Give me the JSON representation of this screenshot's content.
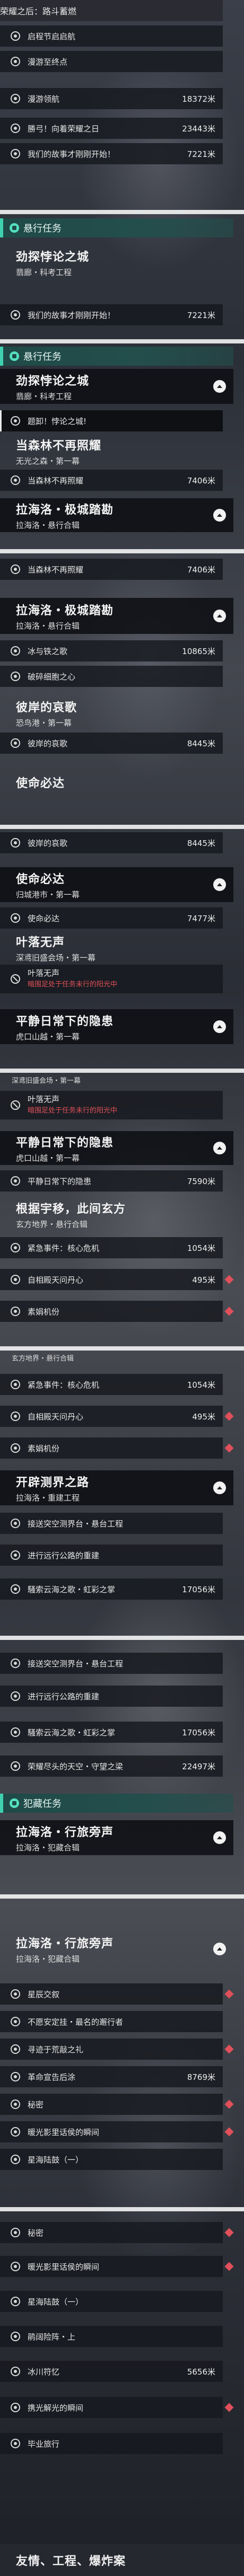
{
  "s1": {
    "top_item": "荣耀之后：路斗蓄燃",
    "rows": [
      {
        "label": "启程节启启航",
        "dist": ""
      },
      {
        "label": "漫游至终点",
        "dist": ""
      },
      {
        "label": "漫游领航",
        "dist": "18372米"
      },
      {
        "label": "勝弓！向着荣耀之日",
        "dist": "23443米"
      },
      {
        "label": "我们的故事才刚刚开始！",
        "dist": "7221米"
      }
    ]
  },
  "s2": {
    "section": "悬行任务",
    "group_title": "劲探悖论之城",
    "group_sub": "翡廊・科考工程",
    "row": {
      "label": "我们的故事才刚刚开始！",
      "dist": "7221米"
    }
  },
  "s3": {
    "section": "悬行任务",
    "group1": {
      "title": "劲探悖论之城",
      "sub": "翡廊・科考工程"
    },
    "row1": {
      "label": "题卸！悖论之城!"
    },
    "group2": {
      "title": "当森林不再照耀",
      "sub": "无光之森・第一幕"
    },
    "row2": {
      "label": "当森林不再照耀",
      "dist": "7406米"
    },
    "group3": {
      "title": "拉海洛・极城踏勘",
      "sub": "拉海洛・悬行合辑"
    }
  },
  "s4": {
    "row0": {
      "label": "当森林不再照耀",
      "dist": "7406米"
    },
    "group1": {
      "title": "拉海洛・极城踏勘",
      "sub": "拉海洛・悬行合辑"
    },
    "rows1": [
      {
        "label": "冰与铁之歌",
        "dist": "10865米"
      },
      {
        "label": "破碎细胞之心",
        "dist": ""
      }
    ],
    "group2": {
      "title": "彼岸的哀歌",
      "sub": "恐鸟港・第一幕"
    },
    "row2": {
      "label": "彼岸的哀歌",
      "dist": "8445米"
    },
    "group3": {
      "title": "使命必达"
    }
  },
  "s5": {
    "row0": {
      "label": "彼岸的哀歌",
      "dist": "8445米"
    },
    "group1": {
      "title": "使命必达",
      "sub": "归城港市・第一幕"
    },
    "row1": {
      "label": "使命必达",
      "dist": "7477米"
    },
    "group2": {
      "title": "叶落无声",
      "sub": "深鸢旧盛会场・第一幕"
    },
    "row2": {
      "label": "叶落无声",
      "note": "暗围足处于任务未行的阳光中"
    },
    "group3": {
      "title": "平静日常下的隐患",
      "sub": "虎口山越・第一幕"
    }
  },
  "s6": {
    "top_text": "深鸢旧盛会场・第一幕",
    "row1": {
      "label": "叶落无声",
      "note": "暗围足处于任务未行的阳光中"
    },
    "group1": {
      "title": "平静日常下的隐患",
      "sub": "虎口山越・第一幕"
    },
    "row2": {
      "label": "平静日常下的隐患",
      "dist": "7590米"
    },
    "group2": {
      "title": "根据宇移，此间玄方",
      "sub": "玄方地界・悬行合辑"
    },
    "rows": [
      {
        "label": "紧急事件：核心危机",
        "dist": "1054米"
      },
      {
        "label": "自相殿天问丹心",
        "dist": "495米"
      },
      {
        "label": "素娟机份",
        "dist": ""
      }
    ]
  },
  "s7": {
    "top_text": "玄方地界・悬行合辑",
    "rows": [
      {
        "label": "紧急事件：核心危机",
        "dist": "1054米"
      },
      {
        "label": "自相殿天问丹心",
        "dist": "495米"
      },
      {
        "label": "素娟机份",
        "dist": ""
      }
    ],
    "group1": {
      "title": "开辟测界之路",
      "sub": "拉海洛・重建工程"
    },
    "rows2": [
      {
        "label": "接送突空测界台・悬台工程",
        "dist": ""
      },
      {
        "label": "进行远行公路的重建",
        "dist": ""
      },
      {
        "label": "騒索云海之歌・虹彩之掌",
        "dist": "17056米"
      }
    ]
  },
  "s8": {
    "rows": [
      {
        "label": "接送突空测界台・悬台工程",
        "dist": ""
      },
      {
        "label": "进行远行公路的重建",
        "dist": ""
      },
      {
        "label": "騒索云海之歌・虹彩之掌",
        "dist": "17056米"
      },
      {
        "label": "荣耀尽头的天空・守望之梁",
        "dist": "22497米"
      }
    ],
    "section": "犯藏任务",
    "group1": {
      "title": "拉海洛・行旅旁声",
      "sub": "拉海洛・犯藏合辑"
    }
  },
  "s9": {
    "group1": {
      "title": "拉海洛・行旅旁声",
      "sub": "拉海洛・犯藏合辑"
    },
    "rows": [
      {
        "label": "星辰交叙",
        "dist": ""
      },
      {
        "label": "不愿安定挂・最名的邂行者",
        "dist": ""
      },
      {
        "label": "寻迹于荒敲之礼",
        "dist": ""
      },
      {
        "label": "革命宣告后涂",
        "dist": "8769米"
      },
      {
        "label": "秘密",
        "dist": ""
      },
      {
        "label": "暖光影里话侯的瞬间",
        "dist": ""
      },
      {
        "label": "星海陆鼓（一）",
        "dist": ""
      }
    ]
  },
  "s10": {
    "rows": [
      {
        "label": "秘密",
        "dist": ""
      },
      {
        "label": "暖光影里话侯的瞬间",
        "dist": ""
      },
      {
        "label": "星海陆鼓（一）",
        "dist": ""
      },
      {
        "label": "鹃阔险阵・上",
        "dist": ""
      },
      {
        "label": "冰川符忆",
        "dist": "5656米"
      },
      {
        "label": "携光解光的瞬间",
        "dist": ""
      },
      {
        "label": "毕业旅行",
        "dist": ""
      }
    ],
    "bottom": "友情、工程、爆炸案"
  }
}
